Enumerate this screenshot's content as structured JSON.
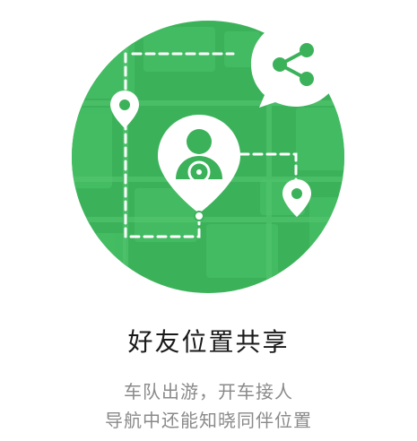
{
  "feature": {
    "title": "好友位置共享",
    "description_line1": "车队出游，开车接人",
    "description_line2": "导航中还能知晓同伴位置"
  },
  "illustration": {
    "main_color": "#3bb25a",
    "icons": [
      "map-circle",
      "driver-location-pin",
      "small-location-pin",
      "share-icon"
    ]
  }
}
